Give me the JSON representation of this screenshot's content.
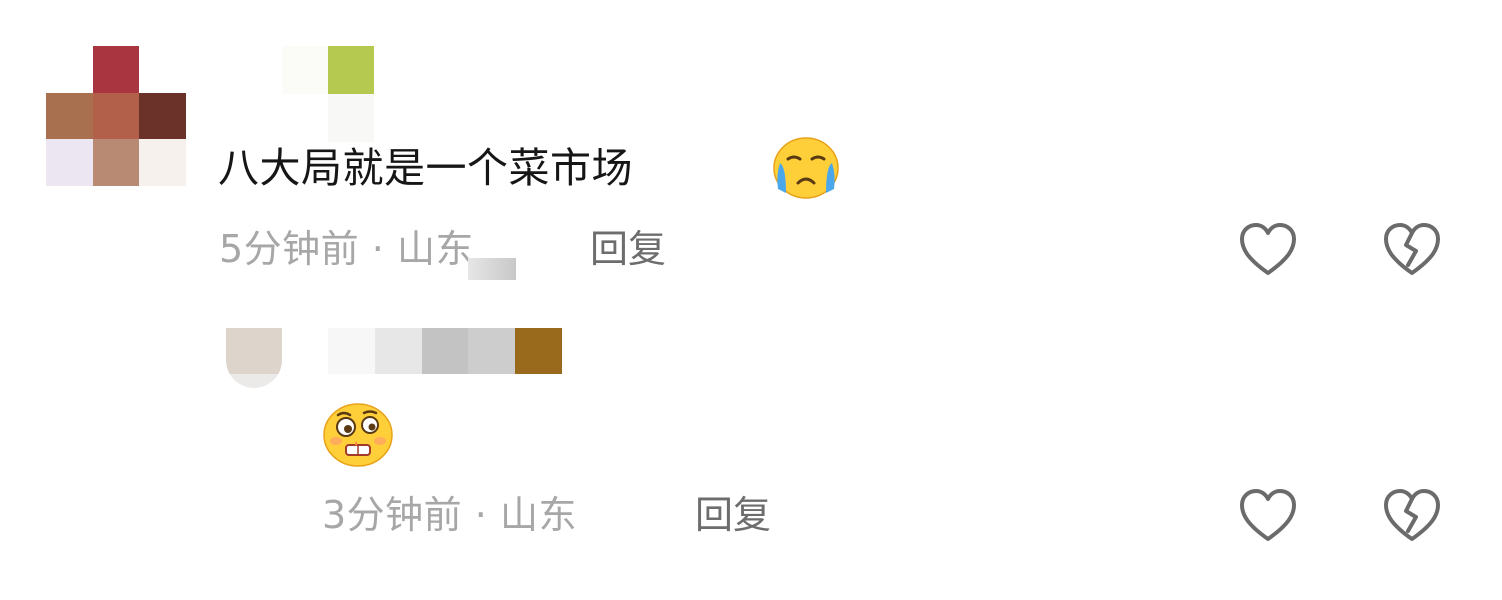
{
  "comments": [
    {
      "text": "八大局就是一个菜市场",
      "emoji": "crying-face",
      "meta_time": "5分钟前",
      "meta_sep": "·",
      "meta_location": "山东",
      "reply_label": "回复",
      "like_icon": "heart-outline-icon",
      "dislike_icon": "broken-heart-icon"
    },
    {
      "text": "",
      "emoji": "pleading-drool-face",
      "meta_time": "3分钟前",
      "meta_sep": "·",
      "meta_location": "山东",
      "reply_label": "回复",
      "like_icon": "heart-outline-icon",
      "dislike_icon": "broken-heart-icon"
    }
  ],
  "colors": {
    "text": "#161616",
    "meta": "#a7a7a7",
    "reply": "#6d6d6d",
    "icon": "#6b6b6b",
    "emoji_yellow": "#ffcf3a",
    "tear_blue": "#4aa7ec"
  }
}
